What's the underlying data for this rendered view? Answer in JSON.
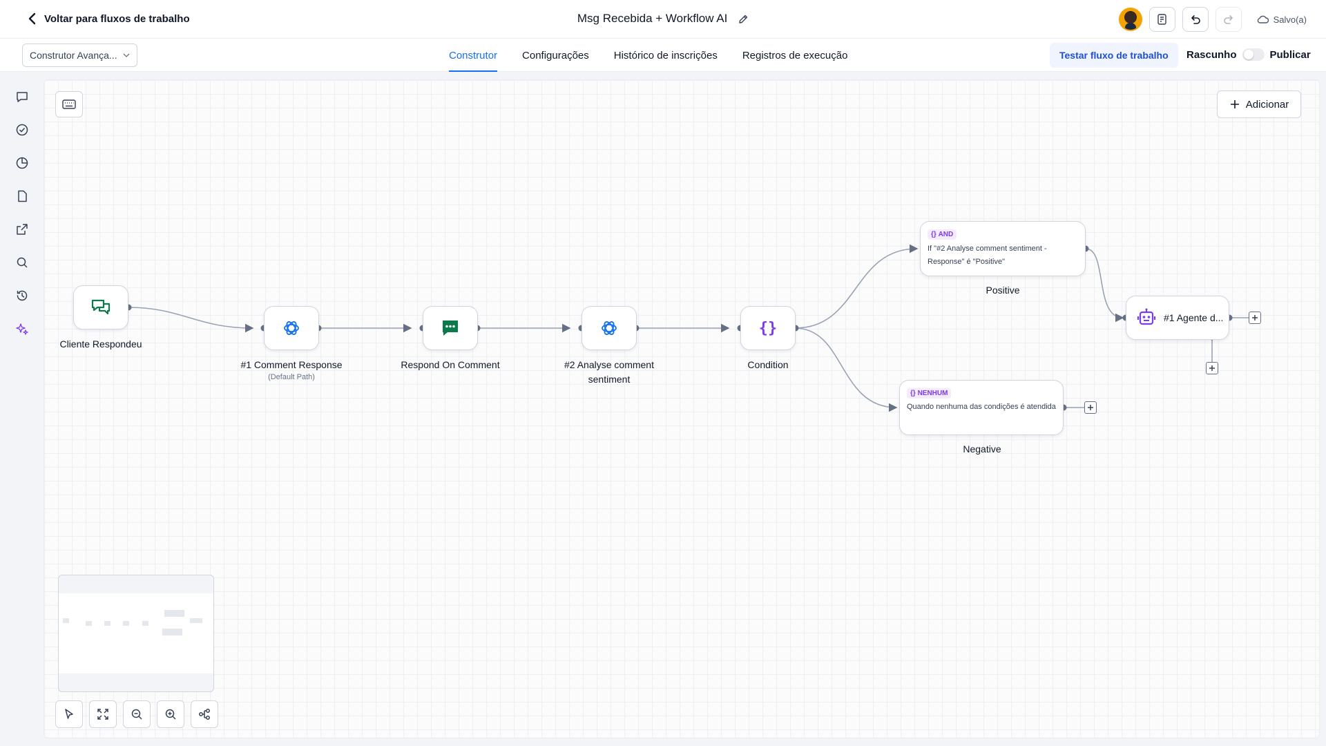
{
  "header": {
    "back_label": "Voltar para fluxos de trabalho",
    "title": "Msg Recebida + Workflow AI",
    "saved_label": "Salvo(a)"
  },
  "toolbar": {
    "mode_select_value": "Construtor Avança...",
    "tabs": [
      {
        "label": "Construtor",
        "active": true
      },
      {
        "label": "Configurações",
        "active": false
      },
      {
        "label": "Histórico de inscrições",
        "active": false
      },
      {
        "label": "Registros de execução",
        "active": false
      }
    ],
    "test_button": "Testar fluxo de trabalho",
    "draft_label": "Rascunho",
    "publish_label": "Publicar",
    "published": false
  },
  "rail": {
    "icons": [
      "chat-icon",
      "check-circle-icon",
      "pie-chart-icon",
      "file-icon",
      "external-link-icon",
      "search-icon",
      "history-icon",
      "sparkles-icon"
    ]
  },
  "canvas": {
    "add_button": "Adicionar",
    "nodes": [
      {
        "id": "trigger",
        "label": "Cliente Respondeu",
        "icon": "chat-bubbles-icon",
        "color": "#0b7a4b"
      },
      {
        "id": "comment-response",
        "label": "#1 Comment Response",
        "sub": "(Default Path)",
        "icon": "openai-icon",
        "color": "#1570ef"
      },
      {
        "id": "respond-comment",
        "label": "Respond On Comment",
        "icon": "comment-icon",
        "color": "#0b7a4b"
      },
      {
        "id": "analyse",
        "label": "#2 Analyse comment sentiment",
        "icon": "openai-icon",
        "color": "#1570ef"
      },
      {
        "id": "condition",
        "label": "Condition",
        "icon": "braces-icon",
        "color": "#7c3aed"
      }
    ],
    "branches": [
      {
        "badge": "AND",
        "text": "If \"#2 Analyse comment sentiment - Response\" é \"Positive\"",
        "label": "Positive"
      },
      {
        "badge": "NENHUM",
        "text": "Quando nenhuma das condições é atendida",
        "label": "Negative"
      }
    ],
    "agent": {
      "label": "#1 Agente d...",
      "icon": "robot-icon",
      "color": "#7c3aed"
    }
  },
  "colors": {
    "accent": "#1570ef",
    "edge": "#98a2b3",
    "handle": "#667085"
  }
}
